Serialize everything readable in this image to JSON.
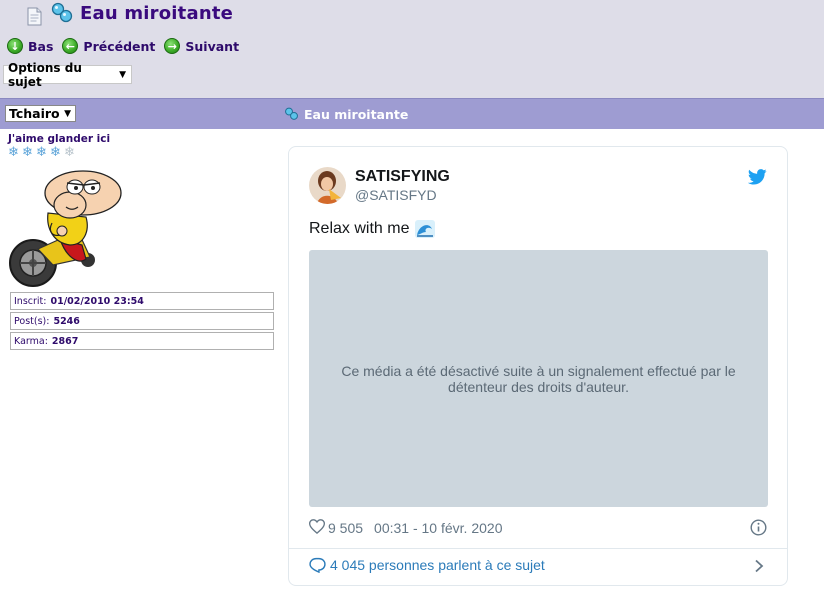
{
  "topic": {
    "title": "Eau miroitante"
  },
  "nav": {
    "down_label": "Bas",
    "prev_label": "Précédent",
    "next_label": "Suivant"
  },
  "options": {
    "selected": "Options du sujet"
  },
  "post": {
    "user_select": "Tchairo",
    "title": "Eau miroitante"
  },
  "profile": {
    "rank": "J'aime glander ici",
    "snowflakes_filled": 4,
    "snowflakes_total": 5,
    "stats": [
      {
        "label": "Inscrit:",
        "value": "01/02/2010 23:54"
      },
      {
        "label": "Post(s):",
        "value": "5246"
      },
      {
        "label": "Karma:",
        "value": "2867"
      }
    ]
  },
  "tweet": {
    "name": "SATISFYING",
    "handle": "@SATISFYD",
    "text": "Relax with me",
    "media_notice": "Ce média a été désactivé suite à un signalement effectué par le détenteur des droits d'auteur.",
    "likes": "9 505",
    "date": "00:31 - 10 févr. 2020",
    "conversation": "4 045 personnes parlent à ce sujet"
  },
  "colors": {
    "title": "#3a0a7e",
    "top_bg": "#dedde8",
    "bar_bg": "#9e9cd2",
    "tweet_link": "#2b7bb9",
    "media_bg": "#ccd6dd"
  }
}
